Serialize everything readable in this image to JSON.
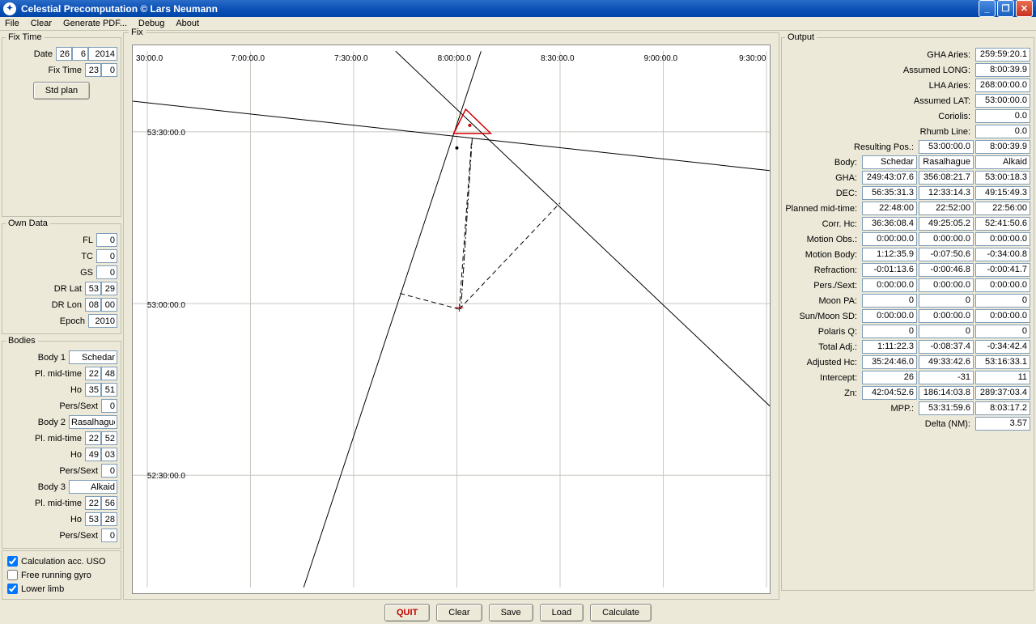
{
  "window": {
    "title": "Celestial Precomputation © Lars Neumann"
  },
  "menu": {
    "file": "File",
    "clear": "Clear",
    "generate_pdf": "Generate PDF...",
    "debug": "Debug",
    "about": "About"
  },
  "fixtime": {
    "legend": "Fix Time",
    "date_label": "Date",
    "date_d": "26",
    "date_m": "6",
    "date_y": "2014",
    "time_label": "Fix Time",
    "time_h": "23",
    "time_m": "0",
    "stdplan": "Std plan"
  },
  "owndata": {
    "legend": "Own Data",
    "fl_label": "FL",
    "fl": "0",
    "tc_label": "TC",
    "tc": "0",
    "gs_label": "GS",
    "gs": "0",
    "drlat_label": "DR Lat",
    "drlat_a": "53",
    "drlat_b": "29",
    "drlon_label": "DR Lon",
    "drlon_a": "08",
    "drlon_b": "00",
    "epoch_label": "Epoch",
    "epoch": "2010"
  },
  "bodies": {
    "legend": "Bodies",
    "body1_label": "Body 1",
    "body1": "Schedar",
    "plmid_label": "Pl. mid-time",
    "ho_label": "Ho",
    "perssext_label": "Pers/Sext",
    "b1_pm_h": "22",
    "b1_pm_m": "48",
    "b1_ho_a": "35",
    "b1_ho_b": "51",
    "b1_ps": "0",
    "body2_label": "Body 2",
    "body2": "Rasalhague",
    "b2_pm_h": "22",
    "b2_pm_m": "52",
    "b2_ho_a": "49",
    "b2_ho_b": "03",
    "b2_ps": "0",
    "body3_label": "Body 3",
    "body3": "Alkaid",
    "b3_pm_h": "22",
    "b3_pm_m": "56",
    "b3_ho_a": "53",
    "b3_ho_b": "28",
    "b3_ps": "0"
  },
  "checks": {
    "calc_uso": "Calculation acc. USO",
    "free_gyro": "Free running gyro",
    "lower_limb": "Lower limb"
  },
  "fix": {
    "legend": "Fix"
  },
  "output": {
    "legend": "Output",
    "rows": [
      {
        "label": "GHA Aries:",
        "vals": [
          "259:59:20.1"
        ]
      },
      {
        "label": "Assumed LONG:",
        "vals": [
          "8:00:39.9"
        ]
      },
      {
        "label": "LHA Aries:",
        "vals": [
          "268:00:00.0"
        ]
      },
      {
        "label": "Assumed LAT:",
        "vals": [
          "53:00:00.0"
        ]
      },
      {
        "label": "Coriolis:",
        "vals": [
          "0.0"
        ]
      },
      {
        "label": "Rhumb Line:",
        "vals": [
          "0.0"
        ]
      },
      {
        "label": "Resulting Pos.:",
        "vals": [
          "53:00:00.0",
          "8:00:39.9"
        ]
      },
      {
        "label": "Body:",
        "vals": [
          "Schedar",
          "Rasalhague",
          "Alkaid"
        ]
      },
      {
        "label": "GHA:",
        "vals": [
          "249:43:07.6",
          "356:08:21.7",
          "53:00:18.3"
        ]
      },
      {
        "label": "DEC:",
        "vals": [
          "56:35:31.3",
          "12:33:14.3",
          "49:15:49.3"
        ]
      },
      {
        "label": "Planned mid-time:",
        "vals": [
          "22:48:00",
          "22:52:00",
          "22:56:00"
        ]
      },
      {
        "label": "Corr. Hc:",
        "vals": [
          "36:36:08.4",
          "49:25:05.2",
          "52:41:50.6"
        ]
      },
      {
        "label": "Motion Obs.:",
        "vals": [
          "0:00:00.0",
          "0:00:00.0",
          "0:00:00.0"
        ]
      },
      {
        "label": "Motion Body:",
        "vals": [
          "1:12:35.9",
          "-0:07:50.6",
          "-0:34:00.8"
        ]
      },
      {
        "label": "Refraction:",
        "vals": [
          "-0:01:13.6",
          "-0:00:46.8",
          "-0:00:41.7"
        ]
      },
      {
        "label": "Pers./Sext:",
        "vals": [
          "0:00:00.0",
          "0:00:00.0",
          "0:00:00.0"
        ]
      },
      {
        "label": "Moon PA:",
        "vals": [
          "0",
          "0",
          "0"
        ]
      },
      {
        "label": "Sun/Moon SD:",
        "vals": [
          "0:00:00.0",
          "0:00:00.0",
          "0:00:00.0"
        ]
      },
      {
        "label": "Polaris Q:",
        "vals": [
          "0",
          "0",
          "0"
        ]
      },
      {
        "label": "Total Adj.:",
        "vals": [
          "1:11:22.3",
          "-0:08:37.4",
          "-0:34:42.4"
        ]
      },
      {
        "label": "Adjusted Hc:",
        "vals": [
          "35:24:46.0",
          "49:33:42.6",
          "53:16:33.1"
        ]
      },
      {
        "label": "Intercept:",
        "vals": [
          "26",
          "-31",
          "11"
        ]
      },
      {
        "label": "Zn:",
        "vals": [
          "42:04:52.6",
          "186:14:03.8",
          "289:37:03.4"
        ]
      },
      {
        "label": "MPP.:",
        "vals": [
          "53:31:59.6",
          "8:03:17.2"
        ]
      },
      {
        "label": "Delta (NM):",
        "vals": [
          "3.57"
        ]
      }
    ]
  },
  "buttons": {
    "quit": "QUIT",
    "clear": "Clear",
    "save": "Save",
    "load": "Load",
    "calculate": "Calculate"
  },
  "chart_data": {
    "type": "diagram",
    "x_ticks": [
      "30:00.0",
      "7:00:00.0",
      "7:30:00.0",
      "8:00:00.0",
      "8:30:00.0",
      "9:00:00.0",
      "9:30:00"
    ],
    "y_ticks": [
      "53:30:00.0",
      "53:00:00.0",
      "52:30:00.0"
    ],
    "xlabel": "",
    "ylabel": "",
    "notes": "Three position lines (black) from LOPs with azimuths 42°, 186°, 290°; DR position at 53:00:00 / 8:00:40 (small red marker); cocked-hat triangle (red) near 53:31 / 8:03; dashed intercept lines from assumed position to each LOP"
  }
}
